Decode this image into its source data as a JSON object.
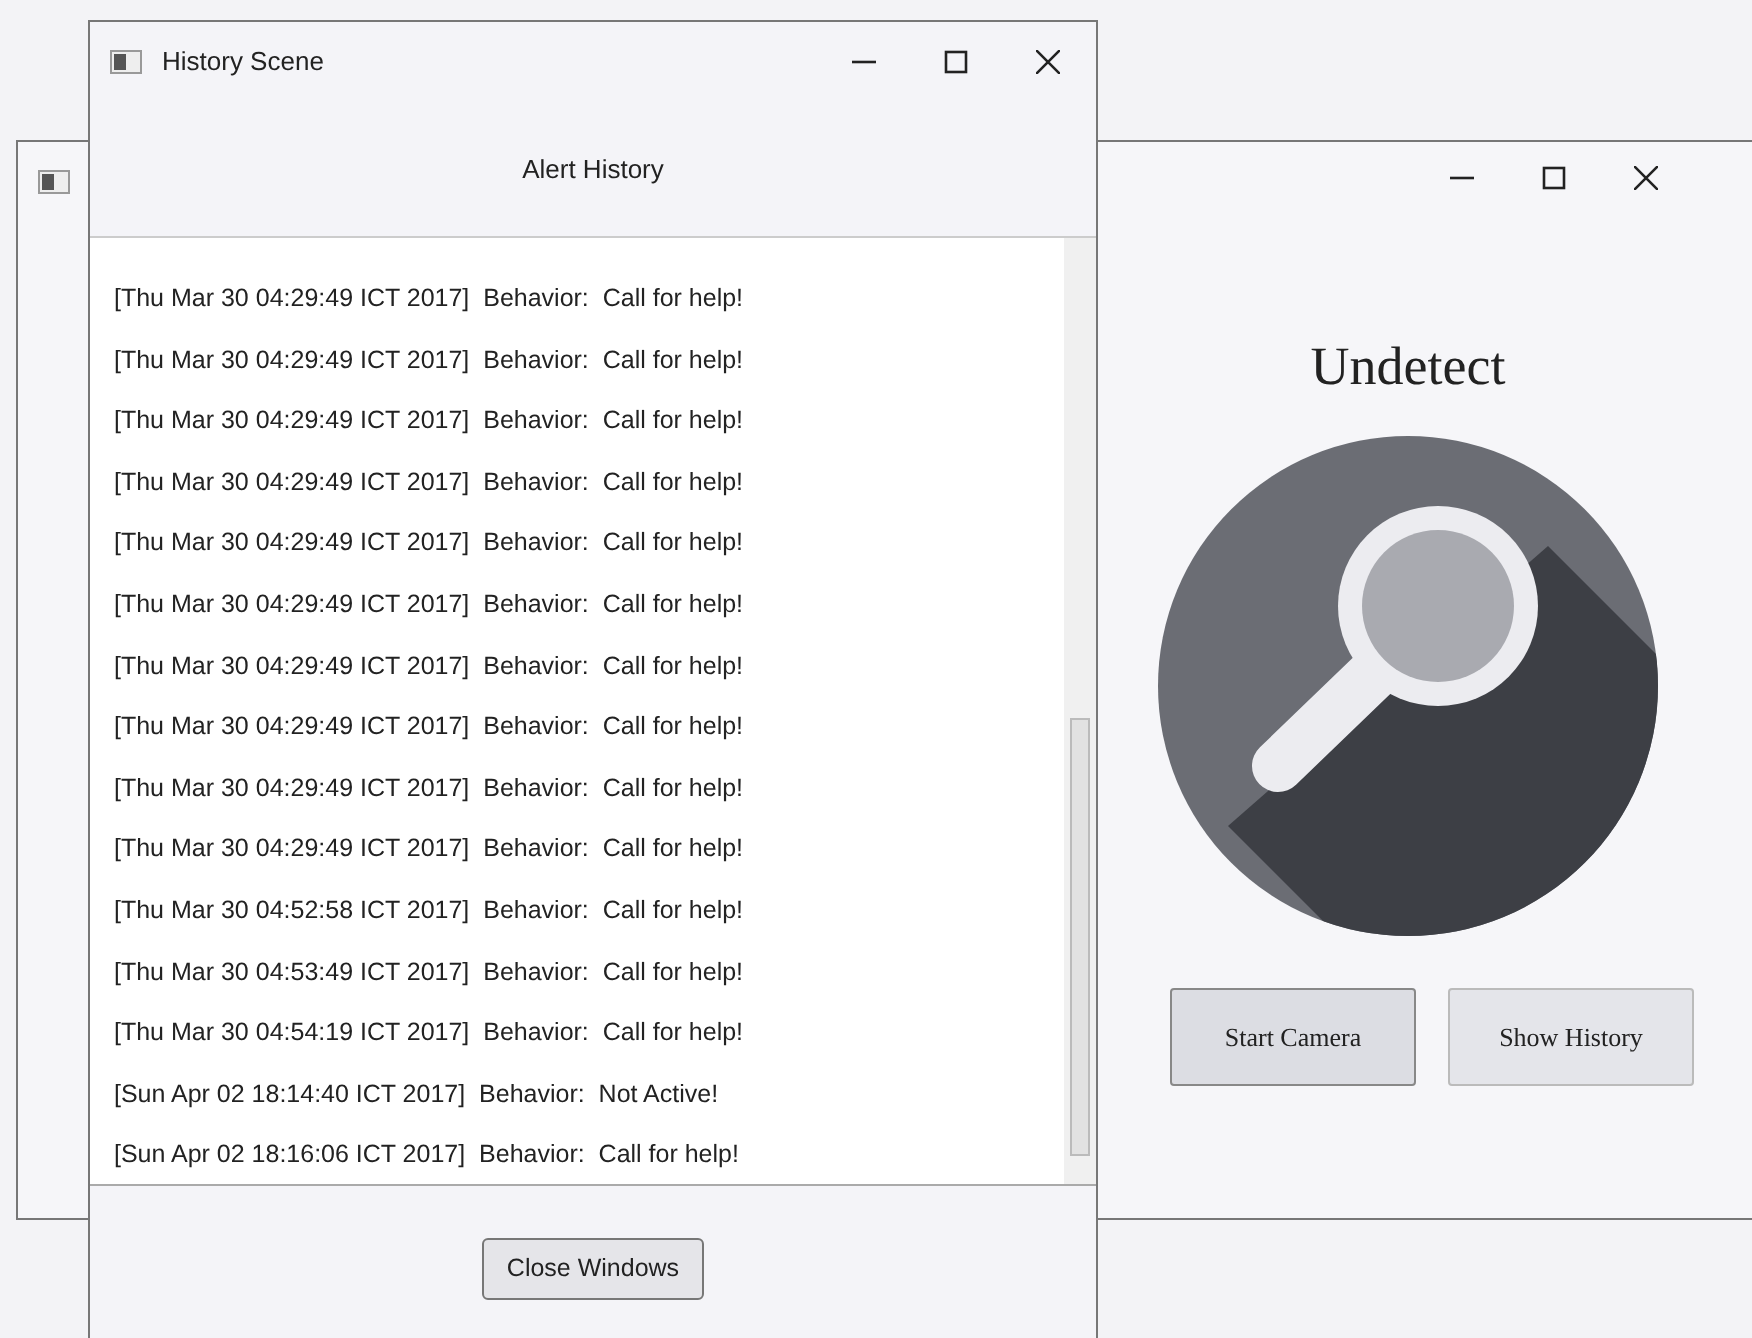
{
  "main_window": {
    "heading": "Undetect",
    "buttons": [
      {
        "label": "Start Camera",
        "kind": "default"
      },
      {
        "label": "Show History",
        "kind": "plain"
      }
    ]
  },
  "history_window": {
    "title": "History Scene",
    "heading": "Alert History",
    "entries": [
      "[Thu Mar 30 04:29:49 ICT 2017]  Behavior:  Call for help!",
      "[Thu Mar 30 04:29:49 ICT 2017]  Behavior:  Call for help!",
      "[Thu Mar 30 04:29:49 ICT 2017]  Behavior:  Call for help!",
      "[Thu Mar 30 04:29:49 ICT 2017]  Behavior:  Call for help!",
      "[Thu Mar 30 04:29:49 ICT 2017]  Behavior:  Call for help!",
      "[Thu Mar 30 04:29:49 ICT 2017]  Behavior:  Call for help!",
      "[Thu Mar 30 04:29:49 ICT 2017]  Behavior:  Call for help!",
      "[Thu Mar 30 04:29:49 ICT 2017]  Behavior:  Call for help!",
      "[Thu Mar 30 04:29:49 ICT 2017]  Behavior:  Call for help!",
      "[Thu Mar 30 04:29:49 ICT 2017]  Behavior:  Call for help!",
      "[Thu Mar 30 04:52:58 ICT 2017]  Behavior:  Call for help!",
      "[Thu Mar 30 04:53:49 ICT 2017]  Behavior:  Call for help!",
      "[Thu Mar 30 04:54:19 ICT 2017]  Behavior:  Call for help!",
      "[Sun Apr 02 18:14:40 ICT 2017]  Behavior:  Not Active!",
      "[Sun Apr 02 18:16:06 ICT 2017]  Behavior:  Call for help!"
    ],
    "button": "Close Windows"
  }
}
